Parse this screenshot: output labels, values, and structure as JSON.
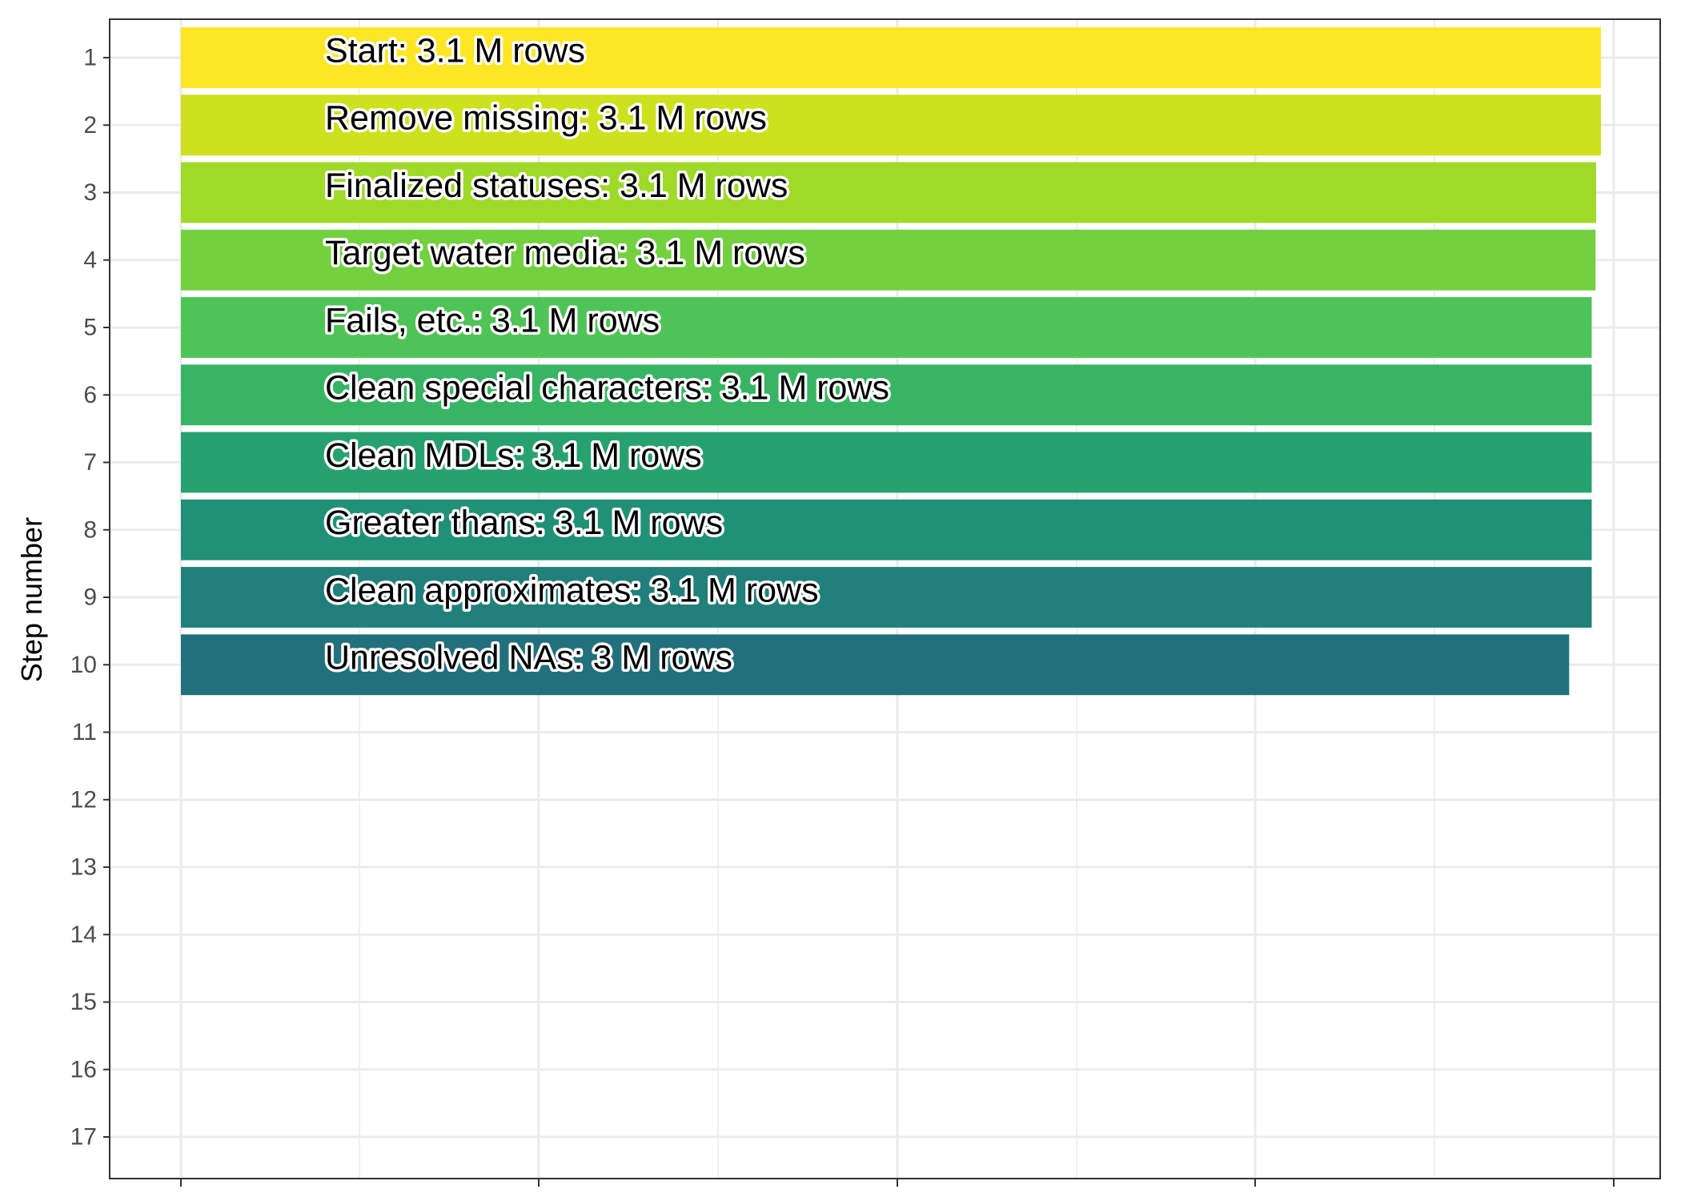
{
  "chart_data": {
    "type": "bar",
    "orientation": "horizontal",
    "ylabel": "Step number",
    "xlabel": "",
    "y_ticks": [
      1,
      2,
      3,
      4,
      5,
      6,
      7,
      8,
      9,
      10,
      11,
      12,
      13,
      14,
      15,
      16,
      17
    ],
    "x_tick_labels": [
      "",
      "",
      "",
      "",
      ""
    ],
    "grid": true,
    "legend": "none",
    "steps": [
      {
        "step": 1,
        "label": "Start:  3.1 M rows",
        "rows_m": 3.1,
        "color": "#FDE725"
      },
      {
        "step": 2,
        "label": "Remove missing:  3.1 M rows",
        "rows_m": 3.1,
        "color": "#CDE11D"
      },
      {
        "step": 3,
        "label": "Finalized statuses:  3.1 M rows",
        "rows_m": 3.1,
        "color": "#9FDA29"
      },
      {
        "step": 4,
        "label": "Target water media:  3.1 M rows",
        "rows_m": 3.1,
        "color": "#73D03F"
      },
      {
        "step": 5,
        "label": "Fails, etc.:  3.1 M rows",
        "rows_m": 3.1,
        "color": "#4FC456"
      },
      {
        "step": 6,
        "label": "Clean special characters:  3.1 M rows",
        "rows_m": 3.1,
        "color": "#37B563"
      },
      {
        "step": 7,
        "label": "Clean MDLs:  3.1 M rows",
        "rows_m": 3.1,
        "color": "#27A26F"
      },
      {
        "step": 8,
        "label": "Greater thans:  3.1 M rows",
        "rows_m": 3.1,
        "color": "#209177"
      },
      {
        "step": 9,
        "label": "Clean approximates:  3.1 M rows",
        "rows_m": 3.1,
        "color": "#21807A"
      },
      {
        "step": 10,
        "label": "Unresolved NAs:  3 M rows",
        "rows_m": 3.0,
        "color": "#22707B"
      }
    ],
    "relative_bar_lengths": [
      1.0,
      1.0,
      0.9966,
      0.9962,
      0.9935,
      0.9935,
      0.9935,
      0.9935,
      0.9935,
      0.9776
    ]
  }
}
